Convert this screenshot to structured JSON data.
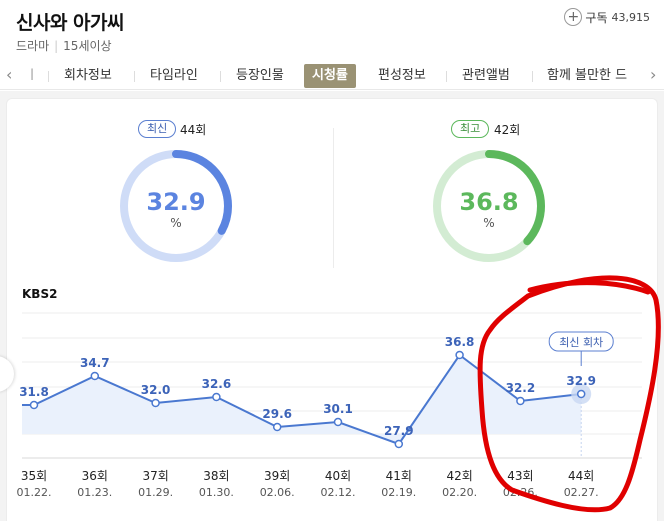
{
  "header": {
    "title": "신사와 아가씨",
    "genre": "드라마",
    "rating": "15세이상",
    "subscribe_label": "구독",
    "subscribe_count": "43,915"
  },
  "tabs": {
    "partial_left": "ㅣ",
    "items": [
      "회차정보",
      "타임라인",
      "등장인물",
      "시청률",
      "편성정보",
      "관련앨범",
      "함께 볼만한 드"
    ],
    "active": "시청률"
  },
  "latest": {
    "badge": "최신",
    "episode": "44회",
    "value": "32.9",
    "unit": "%",
    "fraction": 0.329,
    "color": "#5b84e0",
    "track": "#cfdcf7"
  },
  "highest": {
    "badge": "최고",
    "episode": "42회",
    "value": "36.8",
    "unit": "%",
    "fraction": 0.368,
    "color": "#5cb85c",
    "track": "#d3ecd3"
  },
  "chart_data": {
    "type": "line",
    "title": "KBS2",
    "categories": [
      "35회",
      "36회",
      "37회",
      "38회",
      "39회",
      "40회",
      "41회",
      "42회",
      "43회",
      "44회"
    ],
    "dates": [
      "01.22.",
      "01.23.",
      "01.29.",
      "01.30.",
      "02.06.",
      "02.12.",
      "02.19.",
      "02.20.",
      "02.26.",
      "02.27."
    ],
    "values": [
      31.8,
      34.7,
      32.0,
      32.6,
      29.6,
      30.1,
      27.9,
      36.8,
      32.2,
      32.9
    ],
    "value_labels": [
      "31.8",
      "34.7",
      "32.0",
      "32.6",
      "29.6",
      "30.1",
      "27.9",
      "36.8",
      "32.2",
      "32.9"
    ],
    "latest_tooltip": "최신 회차",
    "line_color": "#4a78d0",
    "fill_color": "#eaf1fc"
  },
  "annotation": {
    "color": "#e00000"
  }
}
